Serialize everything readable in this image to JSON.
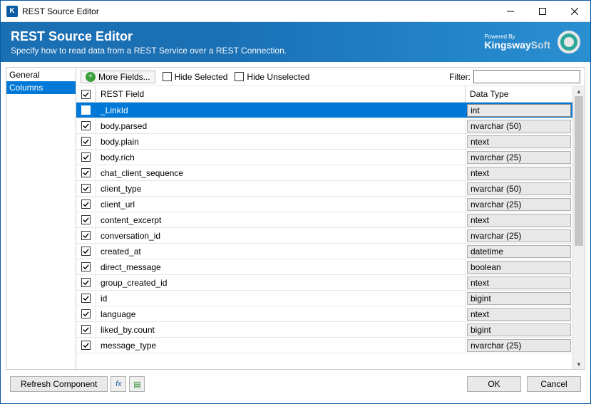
{
  "window": {
    "title": "REST Source Editor"
  },
  "banner": {
    "title": "REST Source Editor",
    "subtitle": "Specify how to read data from a REST Service over a REST Connection.",
    "powered_by": "Powered By",
    "brand1": "Kingsway",
    "brand2": "Soft"
  },
  "sidebar": {
    "items": [
      {
        "label": "General",
        "selected": false
      },
      {
        "label": "Columns",
        "selected": true
      }
    ]
  },
  "toolbar": {
    "more_fields": "More Fields...",
    "hide_selected": "Hide Selected",
    "hide_unselected": "Hide Unselected",
    "filter_label": "Filter:",
    "filter_value": ""
  },
  "grid": {
    "headers": {
      "field": "REST Field",
      "type": "Data Type"
    },
    "rows": [
      {
        "checked": true,
        "field": "_LinkId",
        "type": "int",
        "selected": true
      },
      {
        "checked": true,
        "field": "body.parsed",
        "type": "nvarchar (50)"
      },
      {
        "checked": true,
        "field": "body.plain",
        "type": "ntext"
      },
      {
        "checked": true,
        "field": "body.rich",
        "type": "nvarchar (25)"
      },
      {
        "checked": true,
        "field": "chat_client_sequence",
        "type": "ntext"
      },
      {
        "checked": true,
        "field": "client_type",
        "type": "nvarchar (50)"
      },
      {
        "checked": true,
        "field": "client_url",
        "type": "nvarchar (25)"
      },
      {
        "checked": true,
        "field": "content_excerpt",
        "type": "ntext"
      },
      {
        "checked": true,
        "field": "conversation_id",
        "type": "nvarchar (25)"
      },
      {
        "checked": true,
        "field": "created_at",
        "type": "datetime"
      },
      {
        "checked": true,
        "field": "direct_message",
        "type": "boolean"
      },
      {
        "checked": true,
        "field": "group_created_id",
        "type": "ntext"
      },
      {
        "checked": true,
        "field": "id",
        "type": "bigint"
      },
      {
        "checked": true,
        "field": "language",
        "type": "ntext"
      },
      {
        "checked": true,
        "field": "liked_by.count",
        "type": "bigint"
      },
      {
        "checked": true,
        "field": "message_type",
        "type": "nvarchar (25)"
      }
    ]
  },
  "footer": {
    "refresh": "Refresh Component",
    "ok": "OK",
    "cancel": "Cancel"
  }
}
